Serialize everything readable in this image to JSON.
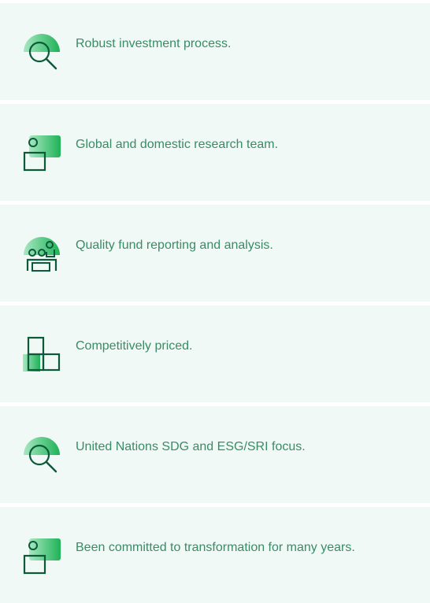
{
  "colors": {
    "card_background": "#f1f9f6",
    "text": "#3a8b66",
    "icon_stroke": "#0b5a3a",
    "icon_gradient_start": "#a7e8c1",
    "icon_gradient_end": "#1fb257"
  },
  "features": [
    {
      "icon": "search-icon",
      "label": "Robust investment process."
    },
    {
      "icon": "research-team-icon",
      "label": "Global and domestic research team."
    },
    {
      "icon": "reporting-people-icon",
      "label": "Quality fund reporting and analysis."
    },
    {
      "icon": "blocks-icon",
      "label": "Competitively priced."
    },
    {
      "icon": "search-icon",
      "label": "United Nations SDG and ESG/SRI focus."
    },
    {
      "icon": "research-team-icon",
      "label": "Been committed to transformation for many years."
    }
  ]
}
